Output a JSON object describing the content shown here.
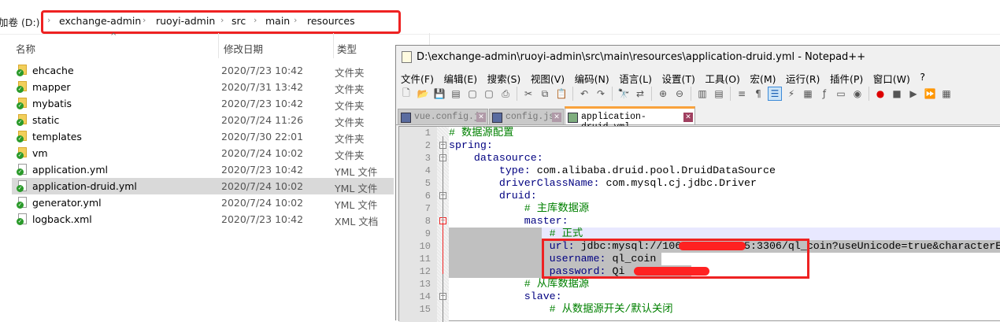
{
  "explorer": {
    "drive_label": "加卷 (D:)",
    "breadcrumb": [
      "exchange-admin",
      "ruoyi-admin",
      "src",
      "main",
      "resources"
    ],
    "columns": {
      "name": "名称",
      "date": "修改日期",
      "type": "类型"
    },
    "files": [
      {
        "name": "ehcache",
        "date": "2020/7/23 10:42",
        "type": "文件夹",
        "kind": "folder"
      },
      {
        "name": "mapper",
        "date": "2020/7/31 13:42",
        "type": "文件夹",
        "kind": "folder"
      },
      {
        "name": "mybatis",
        "date": "2020/7/23 10:42",
        "type": "文件夹",
        "kind": "folder"
      },
      {
        "name": "static",
        "date": "2020/7/24 11:26",
        "type": "文件夹",
        "kind": "folder"
      },
      {
        "name": "templates",
        "date": "2020/7/30 22:01",
        "type": "文件夹",
        "kind": "folder"
      },
      {
        "name": "vm",
        "date": "2020/7/24 10:02",
        "type": "文件夹",
        "kind": "folder"
      },
      {
        "name": "application.yml",
        "date": "2020/7/23 10:42",
        "type": "YML 文件",
        "kind": "file"
      },
      {
        "name": "application-druid.yml",
        "date": "2020/7/24 10:02",
        "type": "YML 文件",
        "kind": "file",
        "selected": true
      },
      {
        "name": "generator.yml",
        "date": "2020/7/24 10:02",
        "type": "YML 文件",
        "kind": "file"
      },
      {
        "name": "logback.xml",
        "date": "2020/7/23 10:42",
        "type": "XML 文档",
        "kind": "file"
      }
    ]
  },
  "notepad": {
    "title": "D:\\exchange-admin\\ruoyi-admin\\src\\main\\resources\\application-druid.yml - Notepad++",
    "menu": [
      "文件(F)",
      "编辑(E)",
      "搜索(S)",
      "视图(V)",
      "编码(N)",
      "语言(L)",
      "设置(T)",
      "工具(O)",
      "宏(M)",
      "运行(R)",
      "插件(P)",
      "窗口(W)",
      "?"
    ],
    "tabs": [
      {
        "label": "vue.config.js"
      },
      {
        "label": "config.js"
      },
      {
        "label": "application-druid.yml",
        "active": true
      }
    ],
    "lines": [
      {
        "n": "1",
        "indent": "",
        "key": "",
        "val": "",
        "comment": "# 数据源配置"
      },
      {
        "n": "2",
        "indent": "",
        "key": "spring:",
        "val": "",
        "comment": ""
      },
      {
        "n": "3",
        "indent": "    ",
        "key": "datasource:",
        "val": "",
        "comment": ""
      },
      {
        "n": "4",
        "indent": "        ",
        "key": "type:",
        "val": " com.alibaba.druid.pool.DruidDataSource",
        "comment": ""
      },
      {
        "n": "5",
        "indent": "        ",
        "key": "driverClassName:",
        "val": " com.mysql.cj.jdbc.Driver",
        "comment": ""
      },
      {
        "n": "6",
        "indent": "        ",
        "key": "druid:",
        "val": "",
        "comment": ""
      },
      {
        "n": "7",
        "indent": "            ",
        "key": "",
        "val": "",
        "comment": "# 主库数据源"
      },
      {
        "n": "8",
        "indent": "            ",
        "key": "master:",
        "val": "",
        "comment": ""
      },
      {
        "n": "9",
        "indent": "                ",
        "key": "",
        "val": "",
        "comment": "# 正式"
      },
      {
        "n": "10",
        "indent": "                ",
        "key": "url:",
        "val": " jdbc:mysql://106.  .   .215:3306/ql_coin?useUnicode=true&characterE",
        "comment": ""
      },
      {
        "n": "11",
        "indent": "                ",
        "key": "username:",
        "val": " ql_coin",
        "comment": ""
      },
      {
        "n": "12",
        "indent": "                ",
        "key": "password:",
        "val": " Qi",
        "comment": ""
      },
      {
        "n": "13",
        "indent": "            ",
        "key": "",
        "val": "",
        "comment": "# 从库数据源"
      },
      {
        "n": "14",
        "indent": "            ",
        "key": "slave:",
        "val": "",
        "comment": ""
      },
      {
        "n": "15",
        "indent": "                ",
        "key": "",
        "val": "",
        "comment": "# 从数据源开关/默认关闭"
      }
    ]
  },
  "colors": {
    "highlight_box": "#ee2222",
    "redaction": "#ff2222",
    "tab_accent": "#f9a23c",
    "selection": "#c0c0c0"
  }
}
